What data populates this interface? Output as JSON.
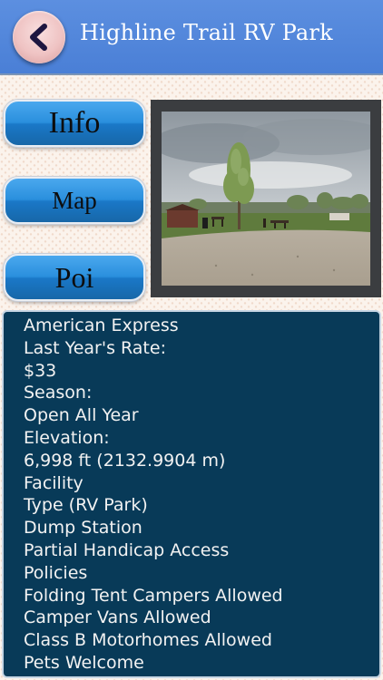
{
  "header": {
    "title": "Highline Trail RV Park",
    "back_icon": "chevron-left-icon"
  },
  "nav": {
    "info_label": "Info",
    "map_label": "Map",
    "poi_label": "Poi"
  },
  "photo": {
    "subject": "campground-photo"
  },
  "details": {
    "lines": [
      "American Express",
      "Last Year's Rate:",
      "$33",
      "Season:",
      "Open All Year",
      "Elevation:",
      "6,998 ft (2132.9904 m)",
      "Facility",
      "Type (RV Park)",
      "Dump Station",
      "Partial Handicap Access",
      "Policies",
      "Folding Tent Campers Allowed",
      "Camper Vans Allowed",
      "Class B Motorhomes Allowed",
      "Pets Welcome"
    ]
  },
  "colors": {
    "header_bg": "#4a7fd6",
    "button_blue": "#2a8fdd",
    "panel_bg": "#083a58",
    "panel_text": "#f2f2f2"
  }
}
